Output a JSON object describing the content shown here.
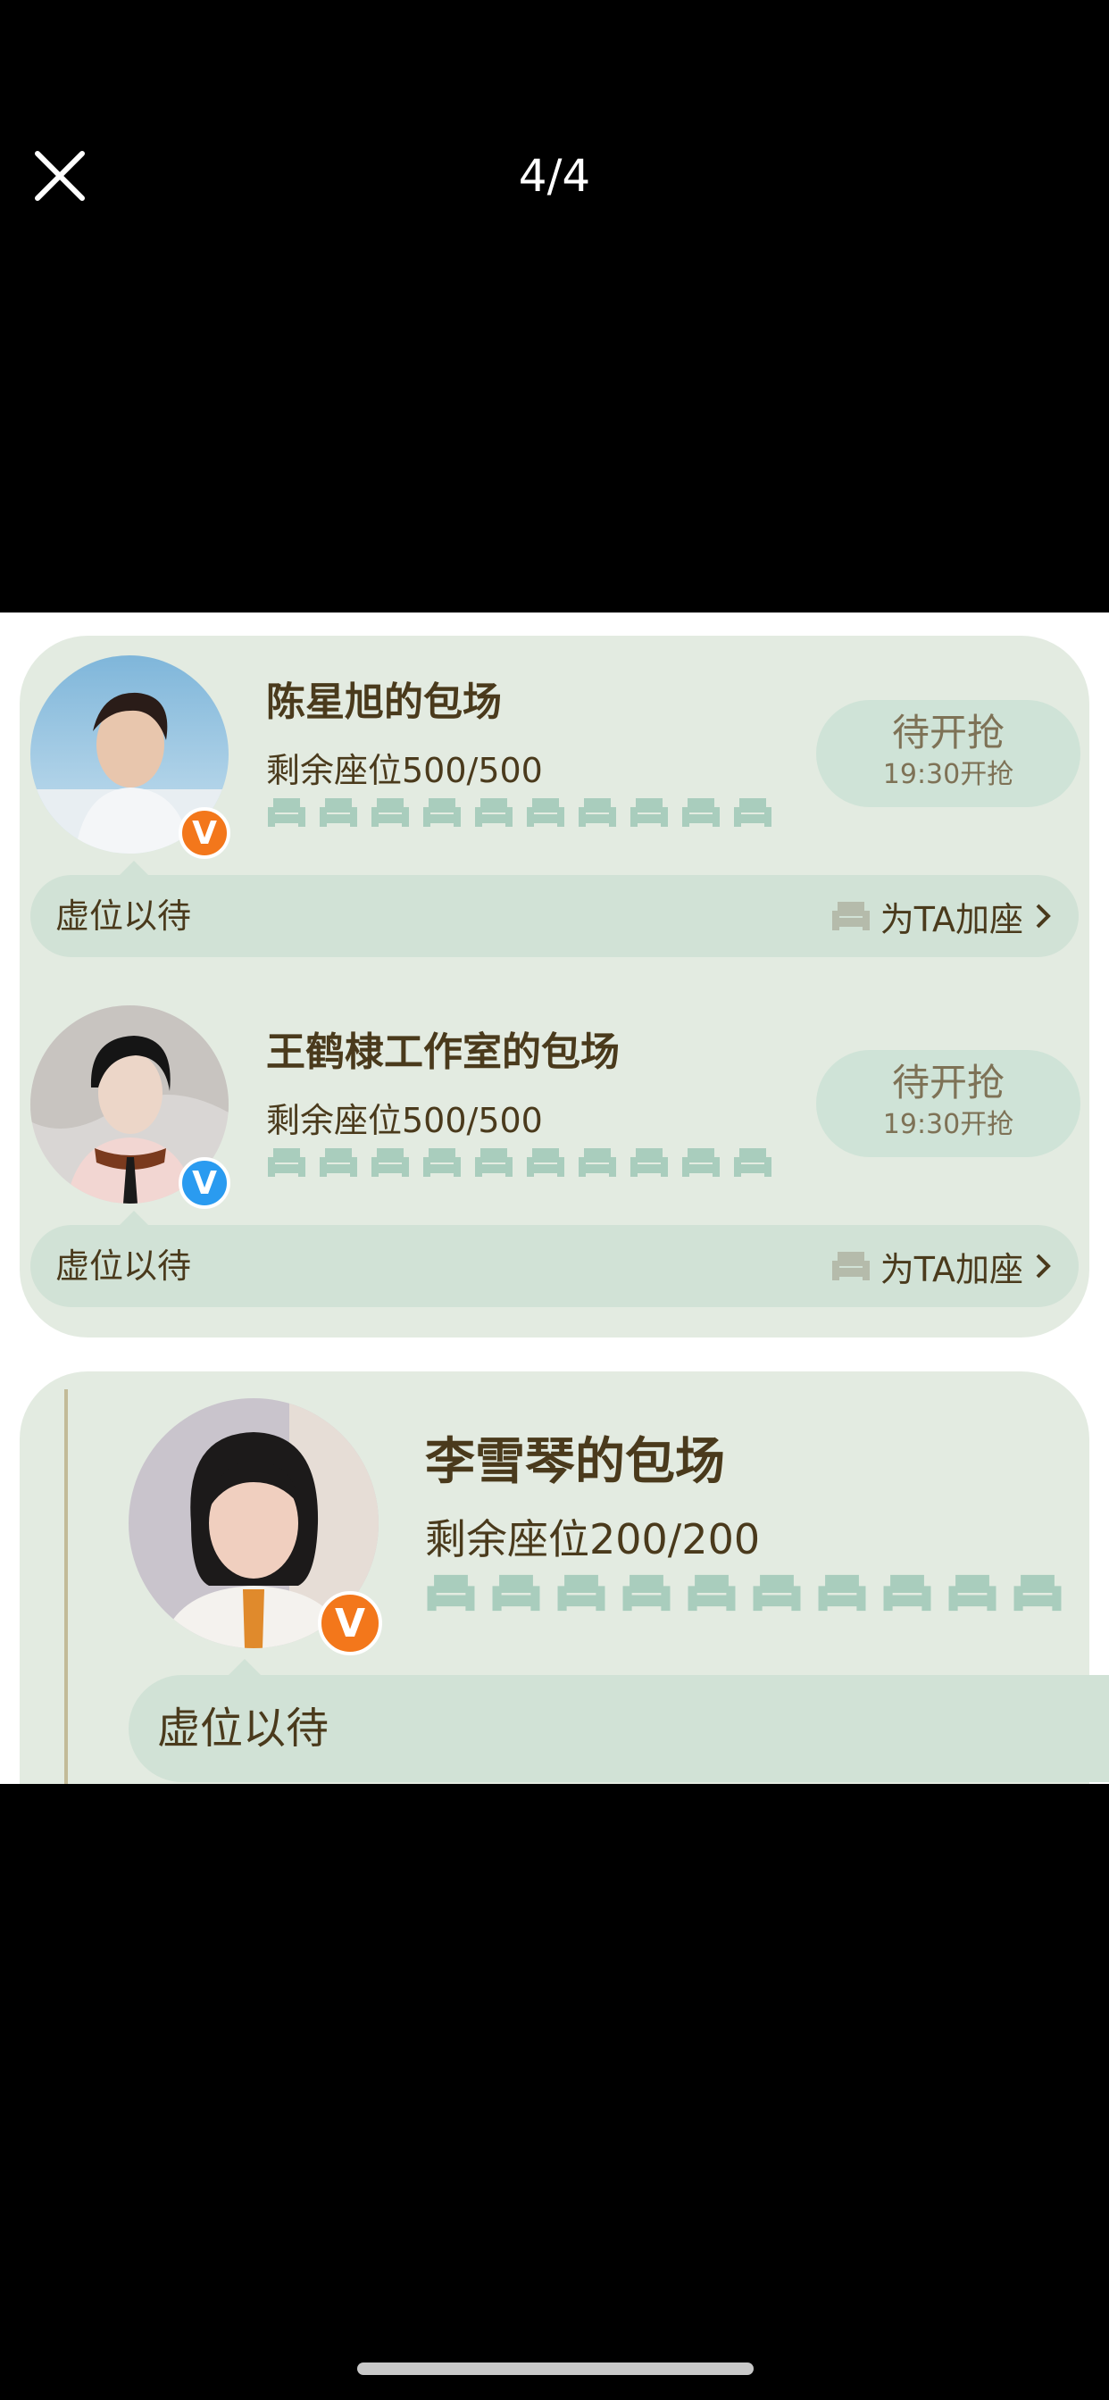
{
  "viewer": {
    "page_counter": "4/4",
    "close_icon": "close-icon"
  },
  "cards": [
    {
      "title": "陈星旭的包场",
      "seats": "剩余座位500/500",
      "badge_color": "#f3771b",
      "button_main": "待开抢",
      "button_sub": "19:30开抢",
      "bar_left": "虚位以待",
      "bar_right": "为TA加座",
      "seat_count_icons": 10
    },
    {
      "title": "王鹤棣工作室的包场",
      "seats": "剩余座位500/500",
      "badge_color": "#2a9bf0",
      "button_main": "待开抢",
      "button_sub": "19:30开抢",
      "bar_left": "虚位以待",
      "bar_right": "为TA加座",
      "seat_count_icons": 10
    },
    {
      "title": "李雪琴的包场",
      "seats": "剩余座位200/200",
      "badge_color": "#f3771b",
      "bar_left": "虚位以待",
      "seat_count_icons": 10
    }
  ],
  "badges": {
    "v_letter": "V"
  },
  "colors": {
    "card_bg": "#e3ebe1",
    "bar_bg": "#d1e2d6",
    "seat_icon": "#a9cdbd",
    "text": "#4a3a1c"
  }
}
